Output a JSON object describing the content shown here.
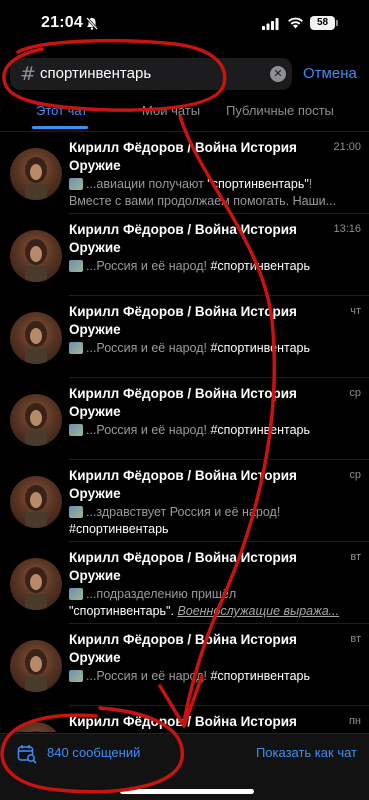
{
  "status": {
    "time": "21:04",
    "battery": "58"
  },
  "search": {
    "query": "спортинвентарь",
    "cancel_label": "Отмена"
  },
  "tabs": [
    {
      "label": "Этот чат",
      "active": true
    },
    {
      "label": "Мои чаты",
      "active": false
    },
    {
      "label": "Публичные посты",
      "active": false
    }
  ],
  "results": [
    {
      "title": "Кирилл Фёдоров / Война История Оружие",
      "date": "21:00",
      "snippet_pre": "...авиации получают ",
      "snippet_hl": "\"спортинвентарь\"",
      "snippet_post": "!",
      "line2": "Вместе с вами продолжаем помогать. Наши..."
    },
    {
      "title": "Кирилл Фёдоров / Война История Оружие",
      "date": "13:16",
      "snippet_pre": "...Россия и её народ! ",
      "snippet_hl": "#спортинвентарь",
      "snippet_post": "",
      "line2": ""
    },
    {
      "title": "Кирилл Фёдоров / Война История Оружие",
      "date": "чт",
      "snippet_pre": "...Россия и её народ! ",
      "snippet_hl": "#спортинвентарь",
      "snippet_post": "",
      "line2": ""
    },
    {
      "title": "Кирилл Фёдоров / Война История Оружие",
      "date": "ср",
      "snippet_pre": "...Россия и её народ! ",
      "snippet_hl": "#спортинвентарь",
      "snippet_post": "",
      "line2": ""
    },
    {
      "title": "Кирилл Фёдоров / Война История Оружие",
      "date": "ср",
      "snippet_pre": "...здравствует Россия и её народ!",
      "snippet_hl": "",
      "snippet_post": "",
      "line2": "#спортинвентарь"
    },
    {
      "title": "Кирилл Фёдоров / Война История Оружие",
      "date": "вт",
      "snippet_pre": "...подразделению пришёл",
      "snippet_hl": "",
      "snippet_post": "",
      "line2": "\"спортинвентарь\". ",
      "line2_link": "Военнослужащие выража..."
    },
    {
      "title": "Кирилл Фёдоров / Война История Оружие",
      "date": "вт",
      "snippet_pre": "...Россия и её народ! ",
      "snippet_hl": "#спортинвентарь",
      "snippet_post": "",
      "line2": ""
    },
    {
      "title": "Кирилл Фёдоров / Война История Оружие",
      "date": "пн",
      "snippet_pre": "",
      "snippet_hl": "",
      "snippet_post": "",
      "line2": ""
    }
  ],
  "bottom_bar": {
    "count_label": "840 сообщений",
    "show_as_chat_label": "Показать как чат"
  },
  "colors": {
    "accent": "#3e8ef7",
    "annotation": "#c8130f",
    "background": "#000000"
  },
  "icons": [
    "mute-bell-icon",
    "signal-icon",
    "wifi-icon",
    "hash-icon",
    "clear-icon",
    "calendar-search-icon"
  ]
}
